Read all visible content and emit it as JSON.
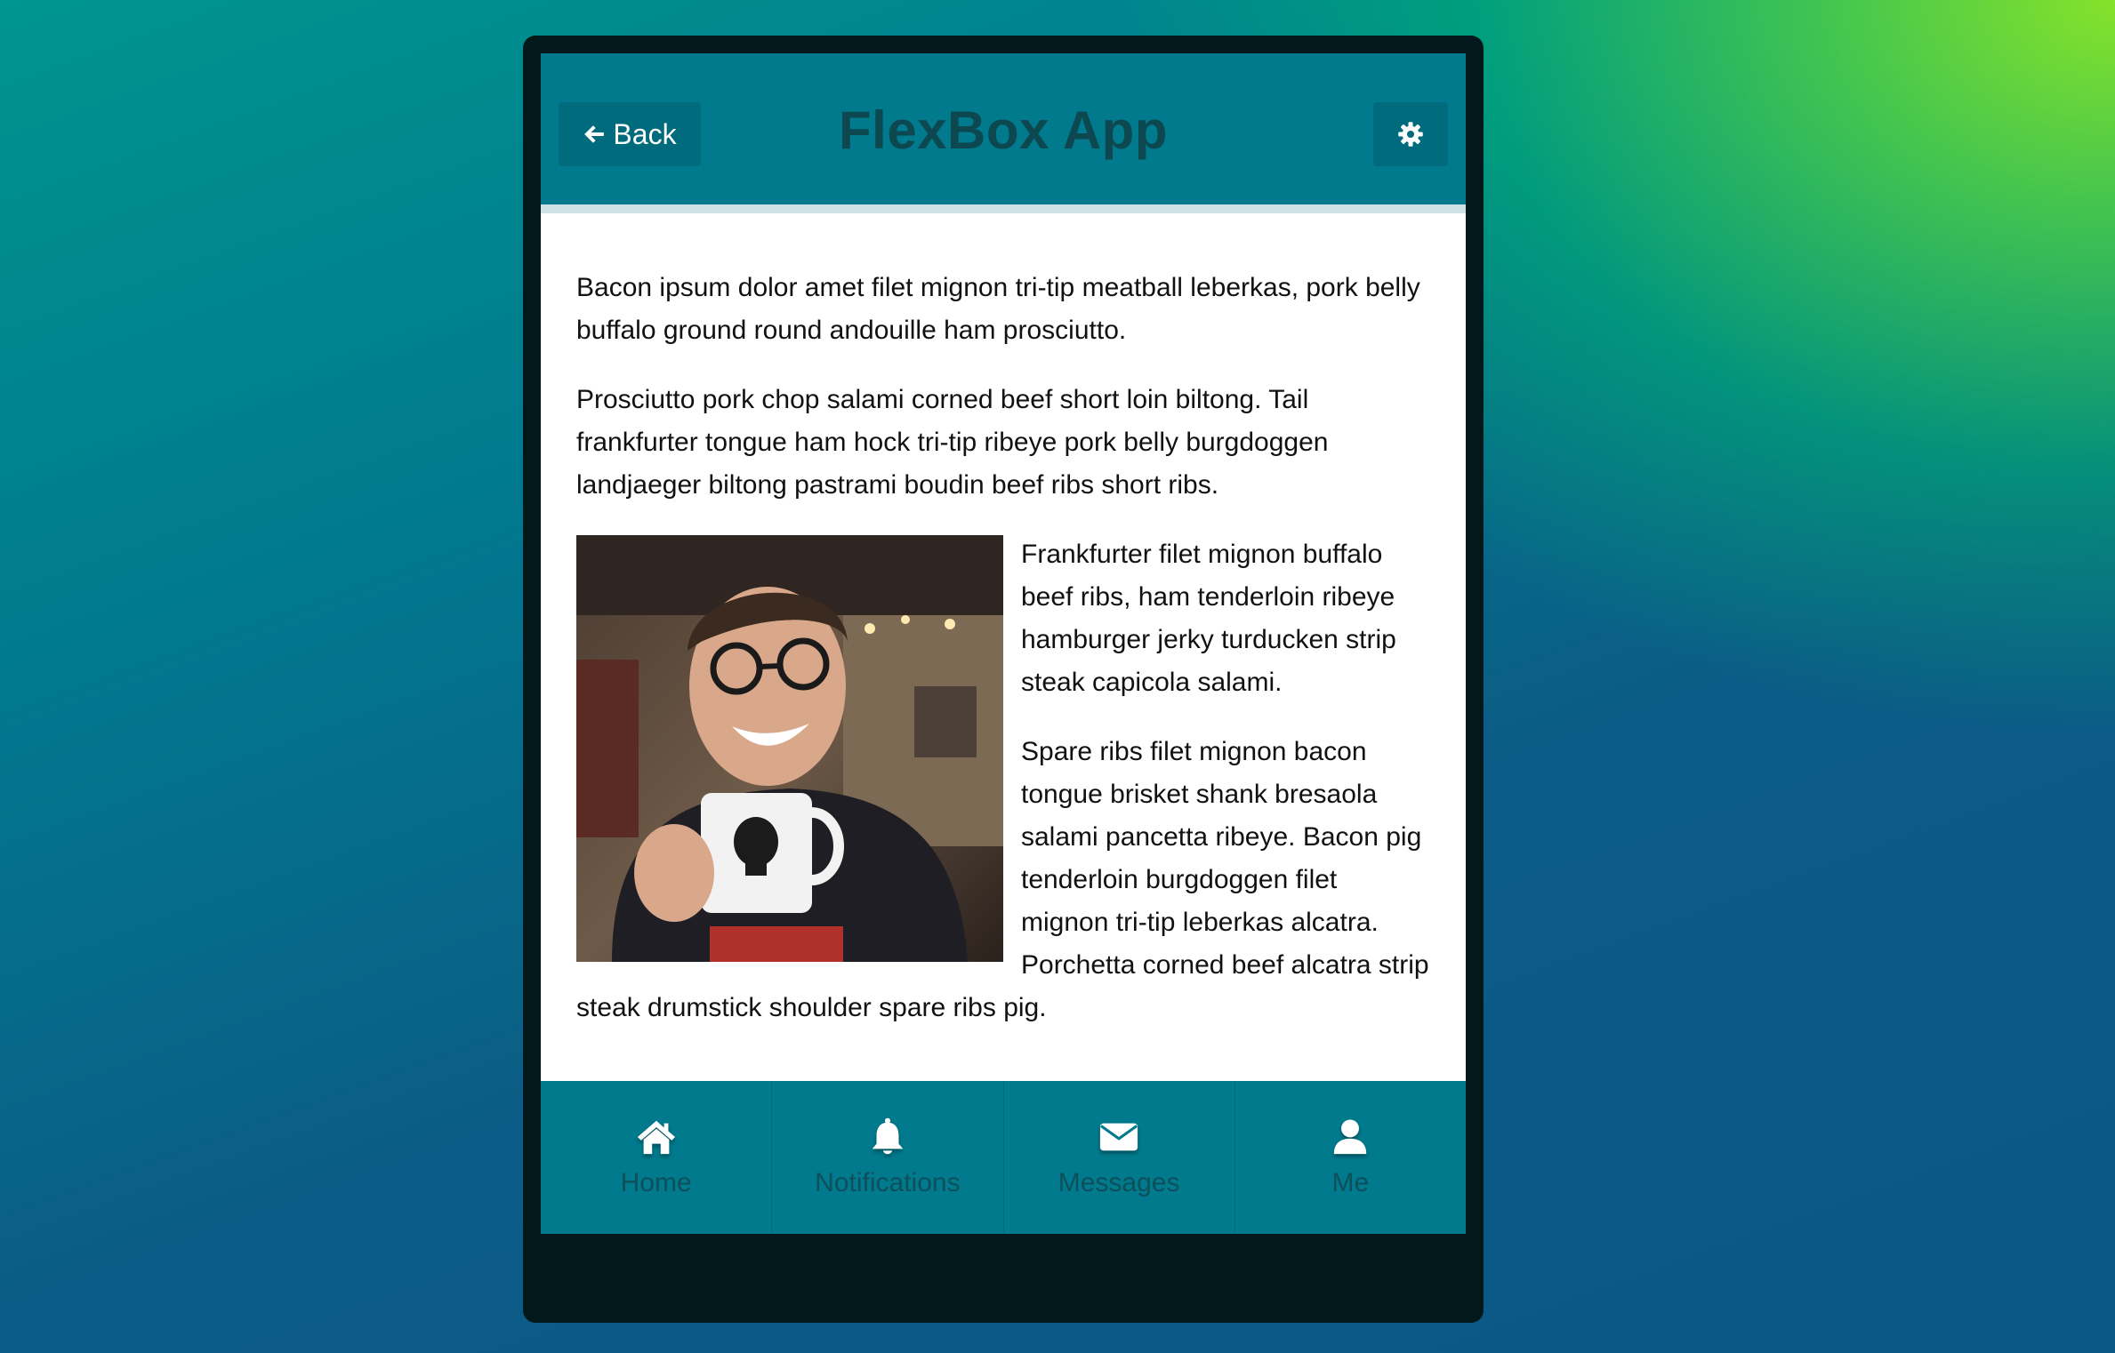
{
  "header": {
    "back_label": "Back",
    "title": "FlexBox App",
    "back_icon": "arrow-left-icon",
    "settings_icon": "gear-icon"
  },
  "content": {
    "paragraphs": [
      "Bacon ipsum dolor amet filet mignon tri-tip meatball leberkas, pork belly buffalo ground round andouille ham prosciutto.",
      "Prosciutto pork chop salami corned beef short loin biltong. Tail frankfurter tongue ham hock tri-tip ribeye pork belly burgdoggen landjaeger biltong pastrami boudin beef ribs short ribs.",
      "Frankfurter filet mignon buffalo beef ribs, ham tenderloin ribeye hamburger jerky turducken strip steak capicola salami.",
      "Spare ribs filet mignon bacon tongue brisket shank bresaola salami pancetta ribeye. Bacon pig tenderloin burgdoggen filet mignon tri-tip leberkas alcatra. Porchetta corned beef alcatra strip steak drumstick shoulder spare ribs pig."
    ]
  },
  "tabbar": {
    "tabs": [
      {
        "label": "Home",
        "icon": "home-icon"
      },
      {
        "label": "Notifications",
        "icon": "bell-icon"
      },
      {
        "label": "Messages",
        "icon": "envelope-icon"
      },
      {
        "label": "Me",
        "icon": "user-icon"
      }
    ]
  },
  "colors": {
    "header_bg": "#007a8c",
    "title_text": "#0d4750",
    "tab_label": "#0d4f5a",
    "device_frame": "#03181b"
  }
}
